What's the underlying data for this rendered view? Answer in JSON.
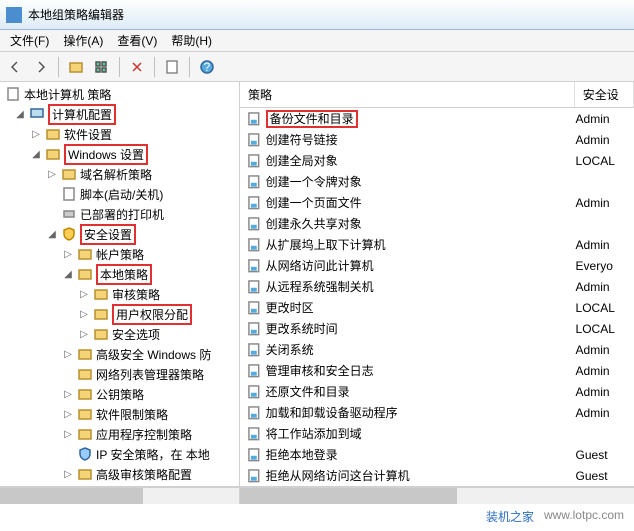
{
  "title": "本地组策略编辑器",
  "menu": {
    "file": "文件(F)",
    "action": "操作(A)",
    "view": "查看(V)",
    "help": "帮助(H)"
  },
  "cols": {
    "policy": "策略",
    "security": "安全设"
  },
  "tree": {
    "root": "本地计算机 策略",
    "n1": "计算机配置",
    "n2": "软件设置",
    "n3": "Windows 设置",
    "n4": "域名解析策略",
    "n5": "脚本(启动/关机)",
    "n6": "已部署的打印机",
    "n7": "安全设置",
    "n8": "帐户策略",
    "n9": "本地策略",
    "n10": "审核策略",
    "n11": "用户权限分配",
    "n12": "安全选项",
    "n13": "高级安全 Windows 防",
    "n14": "网络列表管理器策略",
    "n15": "公钥策略",
    "n16": "软件限制策略",
    "n17": "应用程序控制策略",
    "n18": "IP 安全策略，在 本地",
    "n19": "高级审核策略配置"
  },
  "rows": [
    {
      "t": "备份文件和目录",
      "s": "Admin",
      "hl": true
    },
    {
      "t": "创建符号链接",
      "s": "Admin"
    },
    {
      "t": "创建全局对象",
      "s": "LOCAL"
    },
    {
      "t": "创建一个令牌对象",
      "s": ""
    },
    {
      "t": "创建一个页面文件",
      "s": "Admin"
    },
    {
      "t": "创建永久共享对象",
      "s": ""
    },
    {
      "t": "从扩展坞上取下计算机",
      "s": "Admin"
    },
    {
      "t": "从网络访问此计算机",
      "s": "Everyo"
    },
    {
      "t": "从远程系统强制关机",
      "s": "Admin"
    },
    {
      "t": "更改时区",
      "s": "LOCAL"
    },
    {
      "t": "更改系统时间",
      "s": "LOCAL"
    },
    {
      "t": "关闭系统",
      "s": "Admin"
    },
    {
      "t": "管理审核和安全日志",
      "s": "Admin"
    },
    {
      "t": "还原文件和目录",
      "s": "Admin"
    },
    {
      "t": "加载和卸载设备驱动程序",
      "s": "Admin"
    },
    {
      "t": "将工作站添加到域",
      "s": ""
    },
    {
      "t": "拒绝本地登录",
      "s": "Guest"
    },
    {
      "t": "拒绝从网络访问这台计算机",
      "s": "Guest"
    }
  ],
  "wm": {
    "a": "装机之家",
    "b": "www.lotpc.com"
  }
}
